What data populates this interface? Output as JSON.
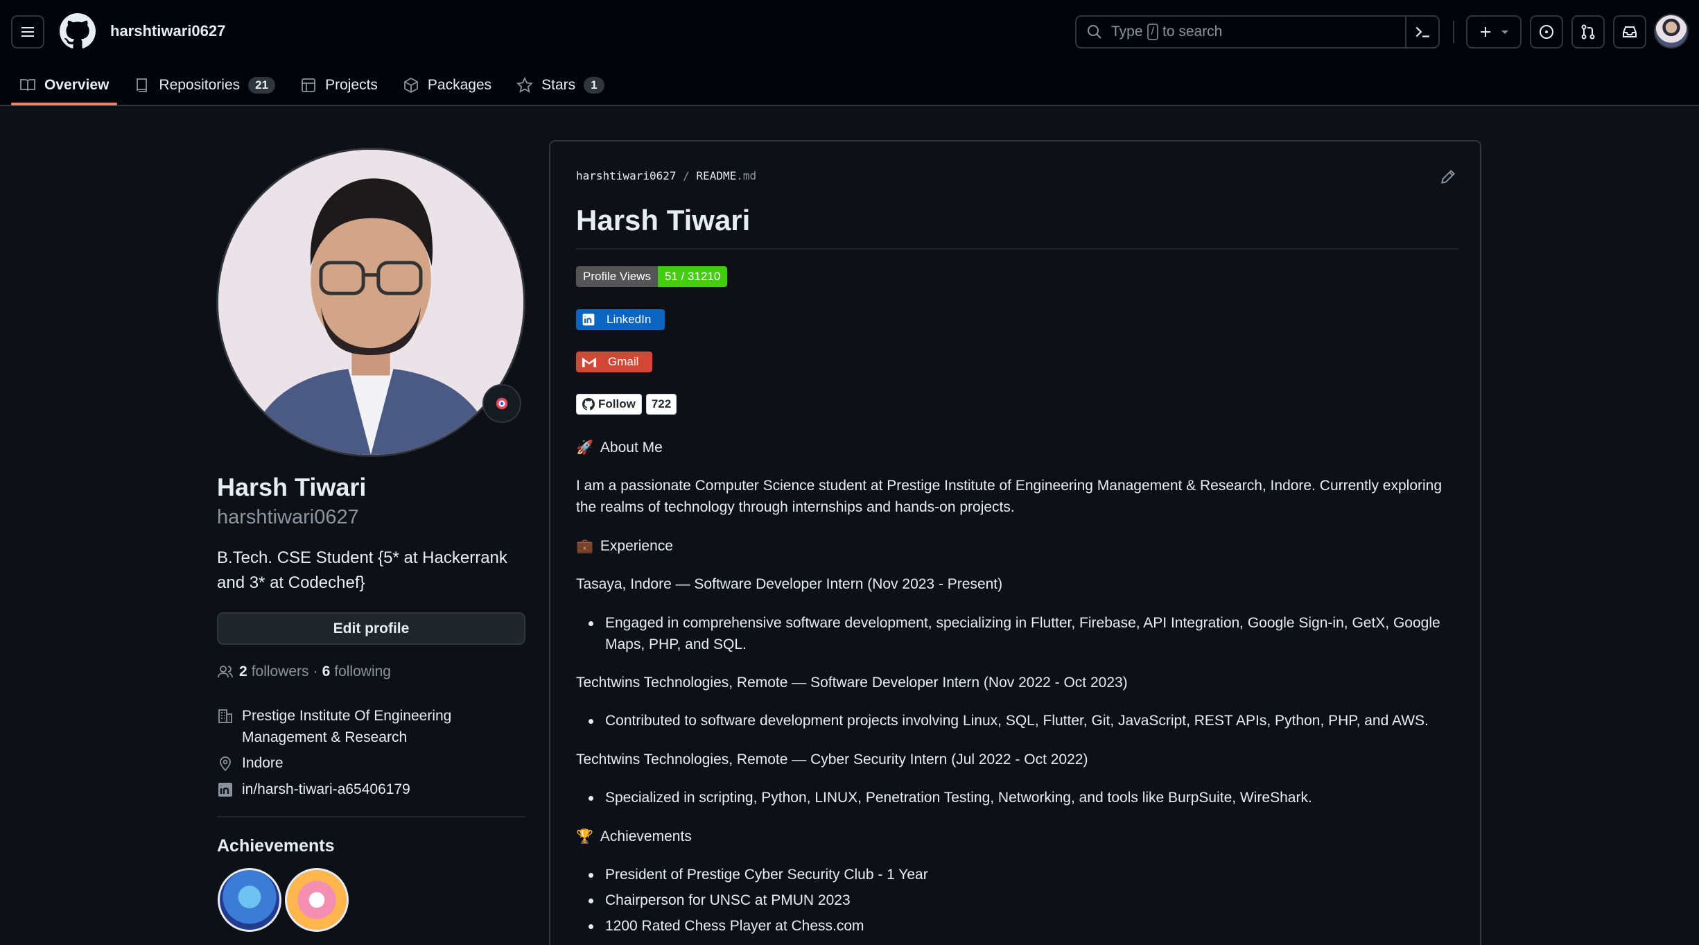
{
  "header": {
    "username": "harshtiwari0627",
    "search": {
      "prefix": "Type",
      "key": "/",
      "suffix": "to search"
    }
  },
  "tabs": [
    {
      "label": "Overview",
      "icon": "book-icon"
    },
    {
      "label": "Repositories",
      "icon": "repo-icon",
      "count": "21"
    },
    {
      "label": "Projects",
      "icon": "table-icon"
    },
    {
      "label": "Packages",
      "icon": "package-icon"
    },
    {
      "label": "Stars",
      "icon": "star-icon",
      "count": "1"
    }
  ],
  "profile": {
    "name": "Harsh Tiwari",
    "login": "harshtiwari0627",
    "bio": "B.Tech. CSE Student {5* at Hackerrank and 3* at Codechef}",
    "edit_label": "Edit profile",
    "followers_count": "2",
    "followers_label": "followers",
    "dot": "·",
    "following_count": "6",
    "following_label": "following",
    "organization": "Prestige Institute Of Engineering Management & Research",
    "location": "Indore",
    "linkedin": "in/harsh-tiwari-a65406179",
    "achievements_title": "Achievements"
  },
  "readme": {
    "crumb_user": "harshtiwari0627",
    "crumb_sep": "/",
    "crumb_file": "README",
    "crumb_ext": ".md",
    "title": "Harsh Tiwari",
    "views_label": "Profile Views",
    "views_value": "51 / 31210",
    "linkedin_label": "LinkedIn",
    "gmail_label": "Gmail",
    "follow_label": "Follow",
    "follow_count": "722",
    "about_heading": "About Me",
    "about_text": "I am a passionate Computer Science student at Prestige Institute of Engineering Management & Research, Indore. Currently exploring the realms of technology through internships and hands-on projects.",
    "experience_heading": "Experience",
    "exp1_title": "Tasaya, Indore — Software Developer Intern (Nov 2023 - Present)",
    "exp1_item": "Engaged in comprehensive software development, specializing in Flutter, Firebase, API Integration, Google Sign-in, GetX, Google Maps, PHP, and SQL.",
    "exp2_title": "Techtwins Technologies, Remote — Software Developer Intern (Nov 2022 - Oct 2023)",
    "exp2_item": "Contributed to software development projects involving Linux, SQL, Flutter, Git, JavaScript, REST APIs, Python, PHP, and AWS.",
    "exp3_title": "Techtwins Technologies, Remote — Cyber Security Intern (Jul 2022 - Oct 2022)",
    "exp3_item": "Specialized in scripting, Python, LINUX, Penetration Testing, Networking, and tools like BurpSuite, WireShark.",
    "achievements_heading": "Achievements",
    "achievements": [
      "President of Prestige Cyber Security Club - 1 Year",
      "Chairperson for UNSC at PMUN 2023",
      "1200 Rated Chess Player at Chess.com"
    ]
  },
  "colors": {
    "background": "#0d1117",
    "header_bg": "#010409",
    "tab_underline": "#f78166",
    "views_value_bg": "#4c1",
    "linkedin_bg": "#0a66c2",
    "gmail_bg": "#d14836"
  }
}
